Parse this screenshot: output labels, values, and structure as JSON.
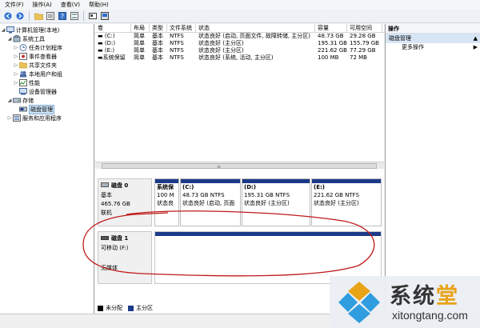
{
  "menu": [
    "文件(F)",
    "操作(A)",
    "查看(V)",
    "帮助(H)"
  ],
  "toolbar_icons": [
    "back-arrow-icon",
    "forward-arrow-icon",
    "folder-icon",
    "details-view-icon",
    "help-icon",
    "list-view-icon",
    "properties-icon",
    "console-icon"
  ],
  "tree": {
    "root": "计算机管理(本地)",
    "system_tools": "系统工具",
    "items": [
      "任务计划程序",
      "事件查看器",
      "共享文件夹",
      "本地用户和组",
      "性能",
      "设备管理器"
    ],
    "storage": "存储",
    "disk_mgmt": "磁盘管理",
    "services": "服务和应用程序"
  },
  "table": {
    "headers": [
      "卷",
      "布局",
      "类型",
      "文件系统",
      "状态",
      "容量",
      "可用空间"
    ],
    "rows": [
      [
        "(C:)",
        "简单",
        "基本",
        "NTFS",
        "状态良好 (启动, 页面文件, 故障转储, 主分区)",
        "48.73 GB",
        "29.28 GB"
      ],
      [
        "(D:)",
        "简单",
        "基本",
        "NTFS",
        "状态良好 (主分区)",
        "195.31 GB",
        "155.79 GB"
      ],
      [
        "(E:)",
        "简单",
        "基本",
        "NTFS",
        "状态良好 (主分区)",
        "221.62 GB",
        "77.29 GB"
      ],
      [
        "系统保留",
        "简单",
        "基本",
        "NTFS",
        "状态良好 (系统, 活动, 主分区)",
        "100 MB",
        "72 MB"
      ]
    ]
  },
  "disk0": {
    "name": "磁盘 0",
    "type": "基本",
    "size": "465.76 GB",
    "status": "联机",
    "partitions": [
      {
        "title": "系统保",
        "line1": "100 M",
        "line2": "状态良"
      },
      {
        "title": "(C:)",
        "line1": "48.73 GB NTFS",
        "line2": "状态良好 (启动, 页面"
      },
      {
        "title": "(D:)",
        "line1": "195.31 GB NTFS",
        "line2": "状态良好 (主分区)"
      },
      {
        "title": "(E:)",
        "line1": "221.62 GB NTFS",
        "line2": "状态良好 (主分区)"
      }
    ]
  },
  "disk1": {
    "name": "磁盘 1",
    "type": "可移动 (F:)",
    "status": "无媒体"
  },
  "legend": {
    "unallocated": "未分配",
    "primary": "主分区",
    "unallocated_color": "#000000",
    "primary_color": "#1b3b88"
  },
  "actions": {
    "header": "操作",
    "section": "磁盘管理",
    "more": "更多操作"
  },
  "watermark": {
    "cn_part1": "系统",
    "cn_part2": "堂",
    "en": "xitongtang.com"
  },
  "colors": {
    "accent_blue": "#1b3b88",
    "selection": "#cde3f7",
    "annotation_red": "#c0191a",
    "watermark_gold": "#e8a317"
  }
}
